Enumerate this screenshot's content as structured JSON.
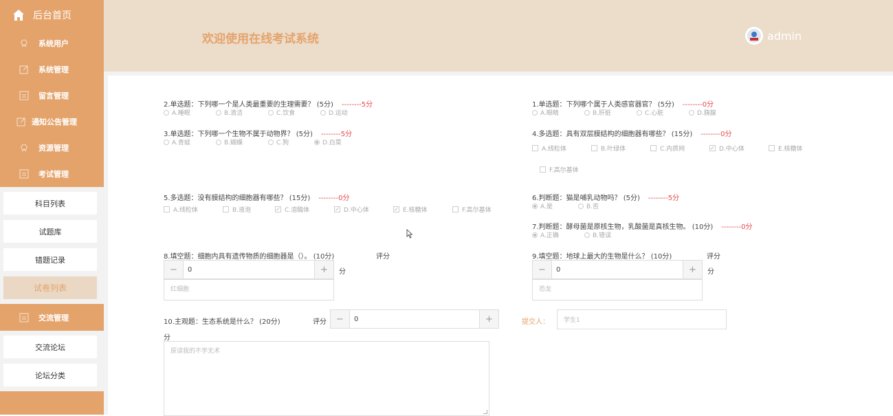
{
  "sidebar": {
    "home_label": "后台首页",
    "menus": [
      {
        "label": "系统用户",
        "icon": "user-icon"
      },
      {
        "label": "系统管理",
        "icon": "edit-icon"
      },
      {
        "label": "留言管理",
        "icon": "message-icon"
      },
      {
        "label": "通知公告管理",
        "icon": "edit-icon"
      },
      {
        "label": "资源管理",
        "icon": "user-icon"
      },
      {
        "label": "考试管理",
        "icon": "message-icon"
      }
    ],
    "exam_sub": [
      "科目列表",
      "试题库",
      "错题记录",
      "试卷列表"
    ],
    "exchange_menu": "交流管理",
    "exchange_sub": [
      "交流论坛",
      "论坛分类"
    ]
  },
  "header": {
    "title": "欢迎使用在线考试系统",
    "user": "admin"
  },
  "questions": {
    "q2": {
      "text": "2.单选题：下列哪一个是人类最重要的生理需要？ (5分)",
      "score": "--------5分",
      "options": [
        "A.睡眠",
        "B.清洁",
        "C.饮食",
        "D.运动"
      ]
    },
    "q3": {
      "text": "3.单选题：下列哪一个生物不属于动物界？ (5分)",
      "score": "--------5分",
      "options": [
        "A.青蛙",
        "B.蝴蝶",
        "C.狗",
        "D.白菜"
      ]
    },
    "q1": {
      "text": "1.单选题：下列哪个属于人类感官器官？ (5分)",
      "score": "--------0分",
      "options": [
        "A.眼睛",
        "B.肝脏",
        "C.心脏",
        "D.胰腺"
      ]
    },
    "q4": {
      "text": "4.多选题：具有双层膜结构的细胞器有哪些？ (15分)",
      "score": "--------0分",
      "options": [
        "A.线粒体",
        "B.叶绿体",
        "C.内质网",
        "D.中心体",
        "E.核糖体",
        "F.高尔基体"
      ]
    },
    "q5": {
      "text": "5.多选题：没有膜结构的细胞器有哪些？ (15分)",
      "score": "--------0分",
      "options": [
        "A.线粒体",
        "B.液泡",
        "C.溶酶体",
        "D.中心体",
        "E.核糖体",
        "F.高尔基体"
      ]
    },
    "q6": {
      "text": "6.判断题：猫是哺乳动物吗？ (5分)",
      "score": "--------5分",
      "options": [
        "A.是",
        "B.否"
      ]
    },
    "q7": {
      "text": "7.判断题：酵母菌是原核生物，乳酸菌是真核生物。 (10分)",
      "score": "--------0分",
      "options": [
        "A.正确",
        "B.错误"
      ]
    },
    "q8": {
      "text": "8.填空题：细胞内具有遗传物质的细胞器是（）。 (10分)",
      "grade_label": "评分",
      "value": "0",
      "unit": "分",
      "answer": "红细胞"
    },
    "q9": {
      "text": "9.填空题：地球上最大的生物是什么？ (10分)",
      "grade_label": "评分",
      "value": "0",
      "unit": "分",
      "answer": "恐龙"
    },
    "q10": {
      "text": "10.主观题：生态系统是什么？ (20分)",
      "grade_label": "评分",
      "value": "0",
      "unit": "分",
      "answer": "原谅我的不学无术"
    }
  },
  "submitter": {
    "label": "提交人：",
    "value": "学生1"
  },
  "stepper_minus": "−",
  "stepper_plus": "+"
}
